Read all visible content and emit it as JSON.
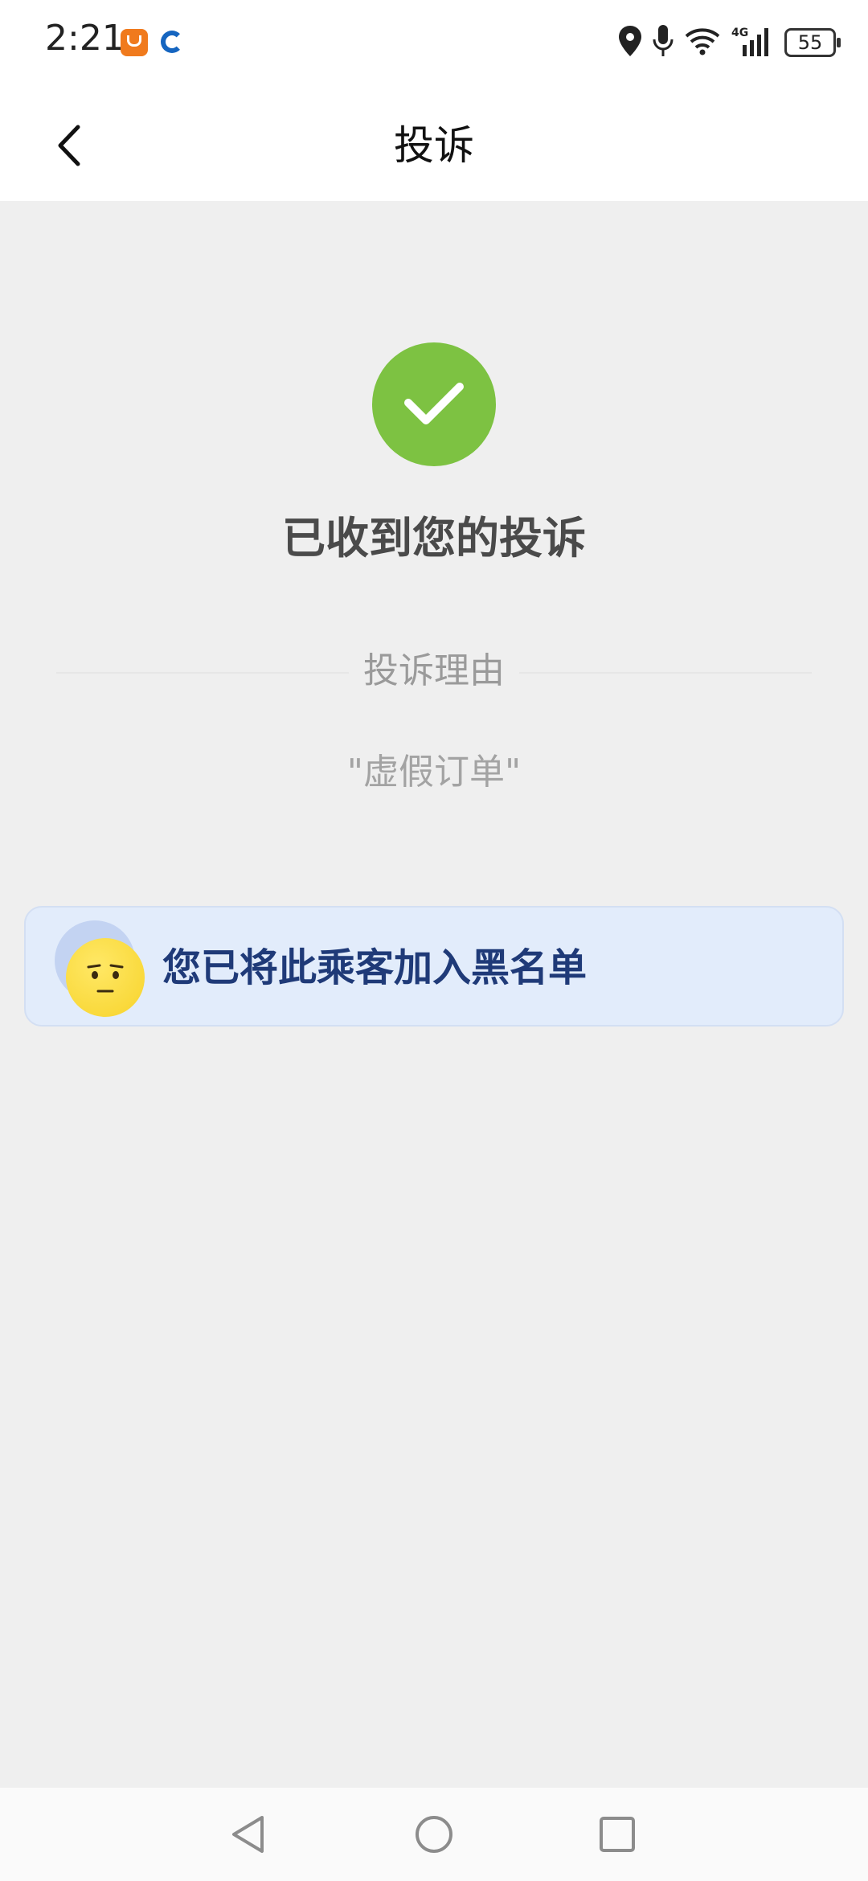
{
  "status_bar": {
    "time": "2:21",
    "battery": "55",
    "network": "4G"
  },
  "header": {
    "title": "投诉"
  },
  "result": {
    "title": "已收到您的投诉",
    "reason_label": "投诉理由",
    "reason_value": "\"虚假订单\""
  },
  "blacklist_card": {
    "text": "您已将此乘客加入黑名单"
  },
  "colors": {
    "success_green": "#7dc242",
    "card_bg": "#e2ecfb",
    "card_text": "#1f3a78"
  }
}
